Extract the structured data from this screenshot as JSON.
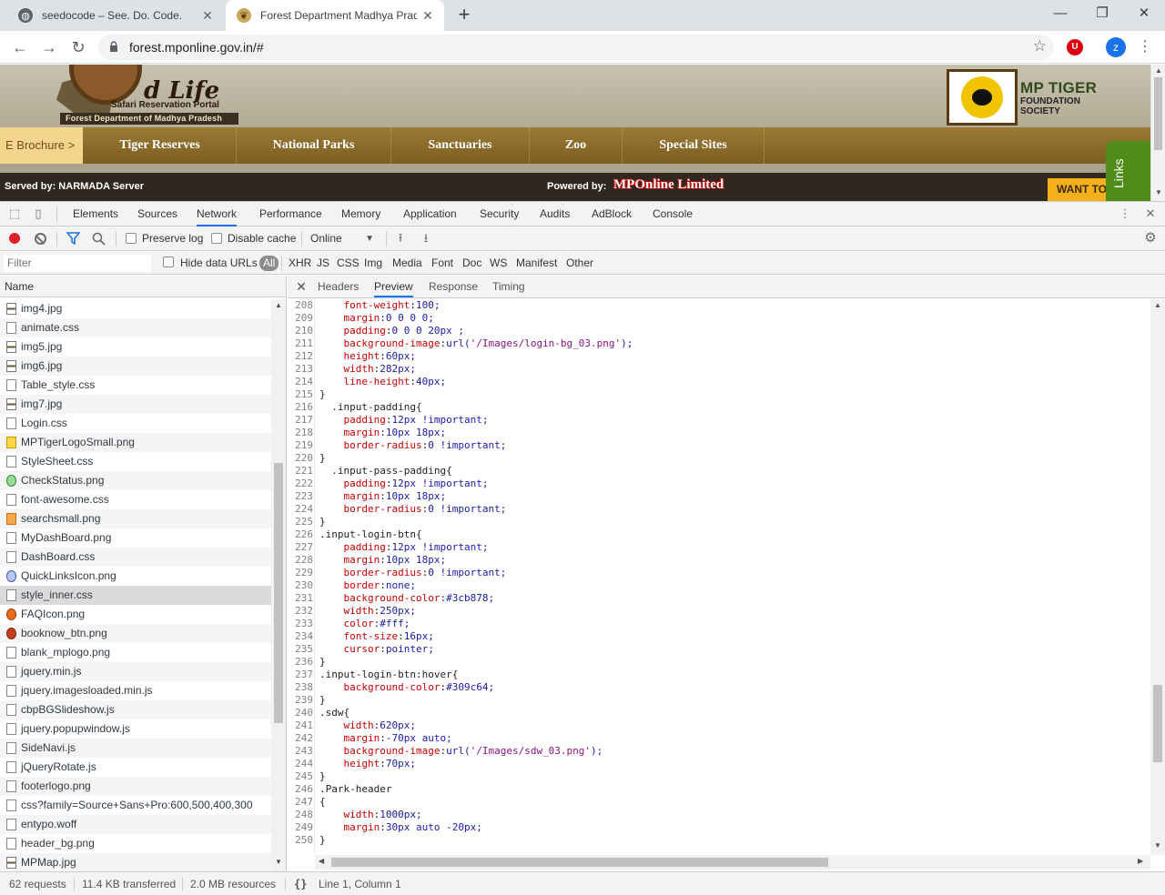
{
  "browser": {
    "tabs": [
      {
        "title": "seedocode – See. Do. Code.",
        "active": false
      },
      {
        "title": "Forest Department Madhya Prad",
        "active": true
      }
    ],
    "url": "forest.mponline.gov.in/#",
    "avatar_letter": "z",
    "ublock_label": "U"
  },
  "site": {
    "logo_life": "d Life",
    "logo_sub": "Safari Reservation Portal",
    "logo_strip": "Forest Department of Madhya Pradesh",
    "tiger_title": "MP TIGER",
    "tiger_sub1": "FOUNDATION",
    "tiger_sub2": "SOCIETY",
    "brochure": "E Brochure >",
    "nav": [
      "Tiger Reserves",
      "National Parks",
      "Sanctuaries",
      "Zoo",
      "Special Sites"
    ],
    "served_by": "Served by: NARMADA Server",
    "powered_by": "Powered by:",
    "mponline": "MPOnline Limited",
    "want_to": "WANT TO",
    "links": "Links"
  },
  "devtools": {
    "tabs": [
      "Elements",
      "Sources",
      "Network",
      "Performance",
      "Memory",
      "Application",
      "Security",
      "Audits",
      "AdBlock",
      "Console"
    ],
    "active_tab": "Network",
    "preserve_log": "Preserve log",
    "disable_cache": "Disable cache",
    "throttle": "Online",
    "filter_placeholder": "Filter",
    "hide_data_urls": "Hide data URLs",
    "types": [
      "All",
      "XHR",
      "JS",
      "CSS",
      "Img",
      "Media",
      "Font",
      "Doc",
      "WS",
      "Manifest",
      "Other"
    ],
    "active_type": "All",
    "name_header": "Name",
    "requests": [
      {
        "name": "img4.jpg",
        "icon": "img"
      },
      {
        "name": "animate.css",
        "icon": "doc"
      },
      {
        "name": "img5.jpg",
        "icon": "img"
      },
      {
        "name": "img6.jpg",
        "icon": "img"
      },
      {
        "name": "Table_style.css",
        "icon": "doc"
      },
      {
        "name": "img7.jpg",
        "icon": "img"
      },
      {
        "name": "Login.css",
        "icon": "doc"
      },
      {
        "name": "MPTigerLogoSmall.png",
        "icon": "color3"
      },
      {
        "name": "StyleSheet.css",
        "icon": "doc"
      },
      {
        "name": "CheckStatus.png",
        "icon": "color2"
      },
      {
        "name": "font-awesome.css",
        "icon": "doc"
      },
      {
        "name": "searchsmall.png",
        "icon": "color1"
      },
      {
        "name": "MyDashBoard.png",
        "icon": "doc"
      },
      {
        "name": "DashBoard.css",
        "icon": "doc"
      },
      {
        "name": "QuickLinksIcon.png",
        "icon": "color4"
      },
      {
        "name": "style_inner.css",
        "icon": "doc",
        "selected": true
      },
      {
        "name": "FAQIcon.png",
        "icon": "color5"
      },
      {
        "name": "booknow_btn.png",
        "icon": "color6"
      },
      {
        "name": "blank_mplogo.png",
        "icon": "doc"
      },
      {
        "name": "jquery.min.js",
        "icon": "doc"
      },
      {
        "name": "jquery.imagesloaded.min.js",
        "icon": "doc"
      },
      {
        "name": "cbpBGSlideshow.js",
        "icon": "doc"
      },
      {
        "name": "jquery.popupwindow.js",
        "icon": "doc"
      },
      {
        "name": "SideNavi.js",
        "icon": "doc"
      },
      {
        "name": "jQueryRotate.js",
        "icon": "doc"
      },
      {
        "name": "footerlogo.png",
        "icon": "doc"
      },
      {
        "name": "css?family=Source+Sans+Pro:600,500,400,300",
        "icon": "doc"
      },
      {
        "name": "entypo.woff",
        "icon": "doc"
      },
      {
        "name": "header_bg.png",
        "icon": "doc"
      },
      {
        "name": "MPMap.jpg",
        "icon": "img"
      }
    ],
    "preview_tabs": [
      "Headers",
      "Preview",
      "Response",
      "Timing"
    ],
    "active_preview_tab": "Preview",
    "code_lines": [
      {
        "n": "208",
        "t": "    font-weight:100;"
      },
      {
        "n": "209",
        "t": "    margin:0 0 0 0;"
      },
      {
        "n": "210",
        "t": "    padding:0 0 0 20px ;"
      },
      {
        "n": "211",
        "t": "    background-image:url('/Images/login-bg_03.png');"
      },
      {
        "n": "212",
        "t": "    height:60px;"
      },
      {
        "n": "213",
        "t": "    width:282px;"
      },
      {
        "n": "214",
        "t": "    line-height:40px;"
      },
      {
        "n": "215",
        "t": "}"
      },
      {
        "n": "216",
        "t": "  .input-padding{"
      },
      {
        "n": "217",
        "t": "    padding:12px !important;"
      },
      {
        "n": "218",
        "t": "    margin:10px 18px;"
      },
      {
        "n": "219",
        "t": "    border-radius:0 !important;"
      },
      {
        "n": "220",
        "t": "}"
      },
      {
        "n": "221",
        "t": "  .input-pass-padding{"
      },
      {
        "n": "222",
        "t": "    padding:12px !important;"
      },
      {
        "n": "223",
        "t": "    margin:10px 18px;"
      },
      {
        "n": "224",
        "t": "    border-radius:0 !important;"
      },
      {
        "n": "225",
        "t": "}"
      },
      {
        "n": "226",
        "t": ".input-login-btn{"
      },
      {
        "n": "227",
        "t": "    padding:12px !important;"
      },
      {
        "n": "228",
        "t": "    margin:10px 18px;"
      },
      {
        "n": "229",
        "t": "    border-radius:0 !important;"
      },
      {
        "n": "230",
        "t": "    border:none;"
      },
      {
        "n": "231",
        "t": "    background-color:#3cb878;"
      },
      {
        "n": "232",
        "t": "    width:250px;"
      },
      {
        "n": "233",
        "t": "    color:#fff;"
      },
      {
        "n": "234",
        "t": "    font-size:16px;"
      },
      {
        "n": "235",
        "t": "    cursor:pointer;"
      },
      {
        "n": "236",
        "t": "}"
      },
      {
        "n": "237",
        "t": ".input-login-btn:hover{"
      },
      {
        "n": "238",
        "t": "    background-color:#309c64;"
      },
      {
        "n": "239",
        "t": "}"
      },
      {
        "n": "240",
        "t": ".sdw{"
      },
      {
        "n": "241",
        "t": "    width:620px;"
      },
      {
        "n": "242",
        "t": "    margin:-70px auto;"
      },
      {
        "n": "243",
        "t": "    background-image:url('/Images/sdw_03.png');"
      },
      {
        "n": "244",
        "t": "    height:70px;"
      },
      {
        "n": "245",
        "t": "}"
      },
      {
        "n": "246",
        "t": ".Park-header"
      },
      {
        "n": "247",
        "t": "{"
      },
      {
        "n": "248",
        "t": "    width:1000px;"
      },
      {
        "n": "249",
        "t": "    margin:30px auto -20px;"
      },
      {
        "n": "250",
        "t": "}"
      }
    ],
    "status": {
      "requests": "62 requests",
      "transferred": "11.4 KB transferred",
      "resources": "2.0 MB resources",
      "cursor": "Line 1, Column 1",
      "format_glyph": "{}"
    }
  },
  "colors": {
    "accent": "#1a73e8",
    "record": "#e0202a",
    "css_property": "#c80000",
    "css_value": "#1a1aa6"
  }
}
